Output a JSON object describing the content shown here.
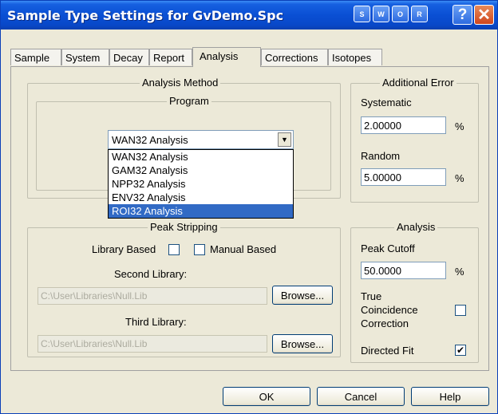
{
  "window": {
    "title": "Sample Type Settings for GvDemo.Spc",
    "title_buttons": [
      "S",
      "W",
      "O",
      "R"
    ],
    "help_glyph": "?",
    "close_glyph": "✕"
  },
  "tabs": [
    "Sample",
    "System",
    "Decay",
    "Report",
    "Analysis",
    "Corrections",
    "Isotopes"
  ],
  "active_tab": "Analysis",
  "analysis_method": {
    "legend": "Analysis Method",
    "program_legend": "Program",
    "selected": "WAN32 Analysis",
    "options": [
      "WAN32 Analysis",
      "GAM32 Analysis",
      "NPP32 Analysis",
      "ENV32 Analysis",
      "ROI32 Analysis"
    ],
    "highlighted": "ROI32 Analysis"
  },
  "additional_error": {
    "legend": "Additional Error",
    "systematic_label": "Systematic",
    "systematic_value": "2.00000",
    "random_label": "Random",
    "random_value": "5.00000",
    "unit": "%"
  },
  "peak_stripping": {
    "legend": "Peak Stripping",
    "library_based_label": "Library Based",
    "library_based_checked": false,
    "manual_based_label": "Manual Based",
    "manual_based_checked": false,
    "second_library_label": "Second Library:",
    "second_library_value": "C:\\User\\Libraries\\Null.Lib",
    "third_library_label": "Third Library:",
    "third_library_value": "C:\\User\\Libraries\\Null.Lib",
    "browse_label": "Browse..."
  },
  "analysis": {
    "legend": "Analysis",
    "peak_cutoff_label": "Peak Cutoff",
    "peak_cutoff_value": "50.0000",
    "unit": "%",
    "true_coincidence_line1": "True",
    "true_coincidence_line2": "Coincidence",
    "true_coincidence_line3": "Correction",
    "true_coincidence_checked": false,
    "directed_fit_label": "Directed Fit",
    "directed_fit_checked": true,
    "check_glyph": "✔"
  },
  "footer": {
    "ok_label": "OK",
    "cancel_label": "Cancel",
    "help_label": "Help"
  }
}
